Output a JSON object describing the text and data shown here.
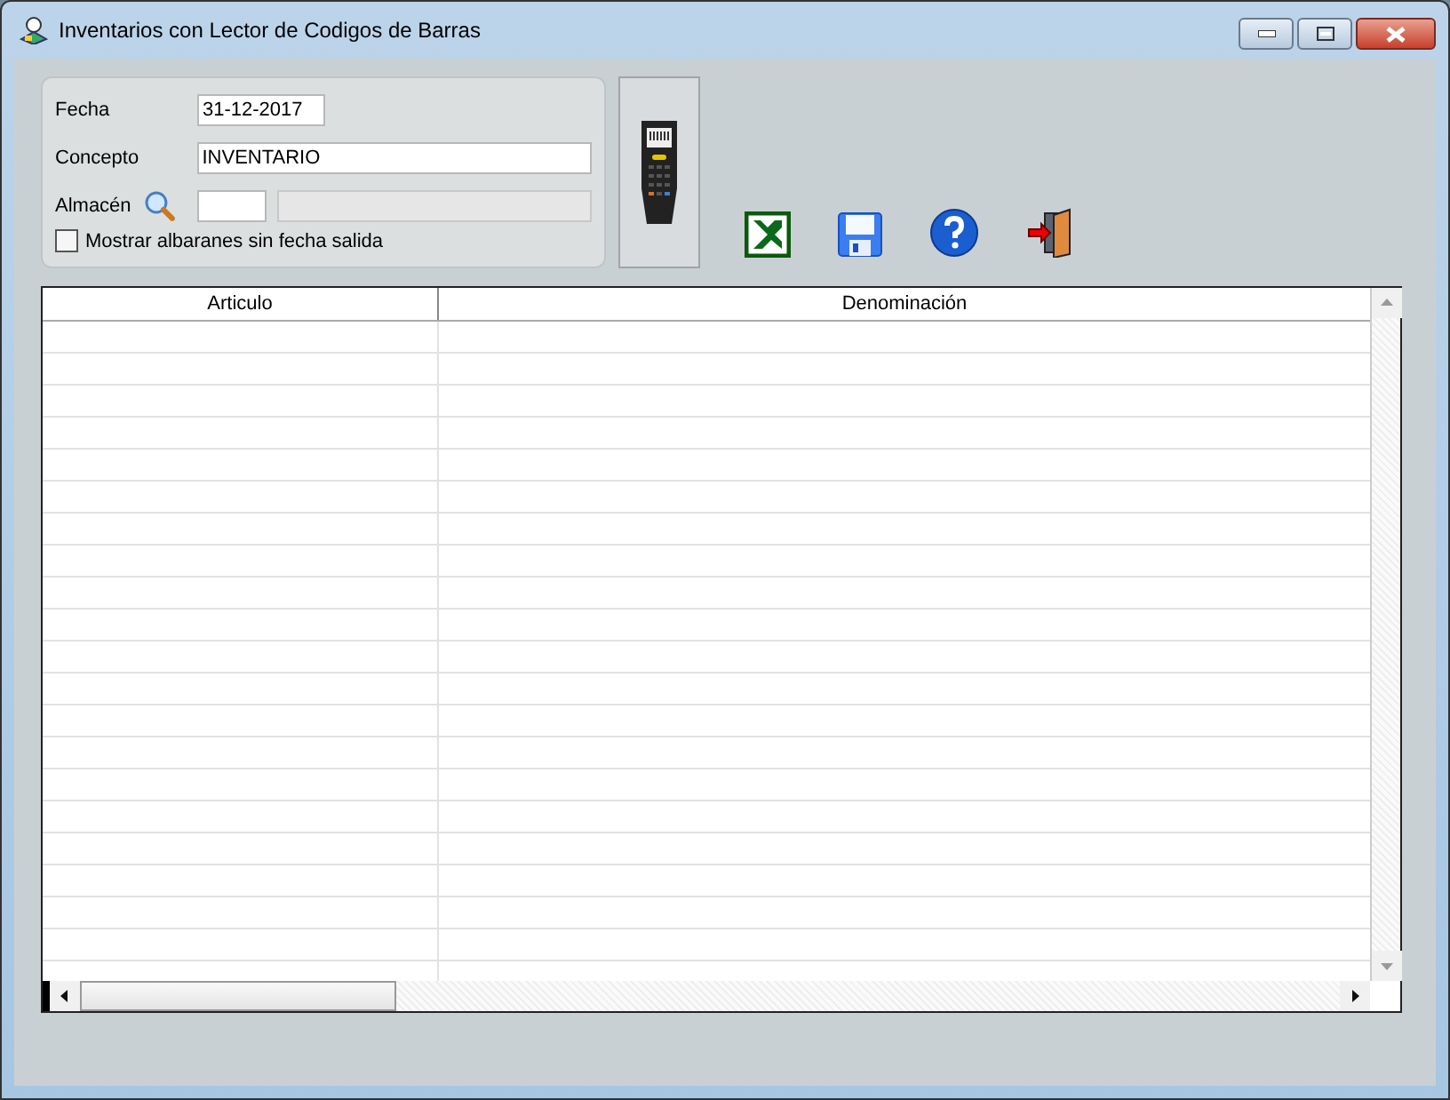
{
  "window": {
    "title": "Inventarios con Lector de Codigos de Barras"
  },
  "form": {
    "fecha": {
      "label": "Fecha",
      "value": "31-12-2017"
    },
    "concepto": {
      "label": "Concepto",
      "value": "INVENTARIO"
    },
    "almacen": {
      "label": "Almacén"
    },
    "checkbox": {
      "label": "Mostrar albaranes sin fecha salida",
      "checked": false
    }
  },
  "table": {
    "columns": [
      "Articulo",
      "Denominación"
    ]
  }
}
